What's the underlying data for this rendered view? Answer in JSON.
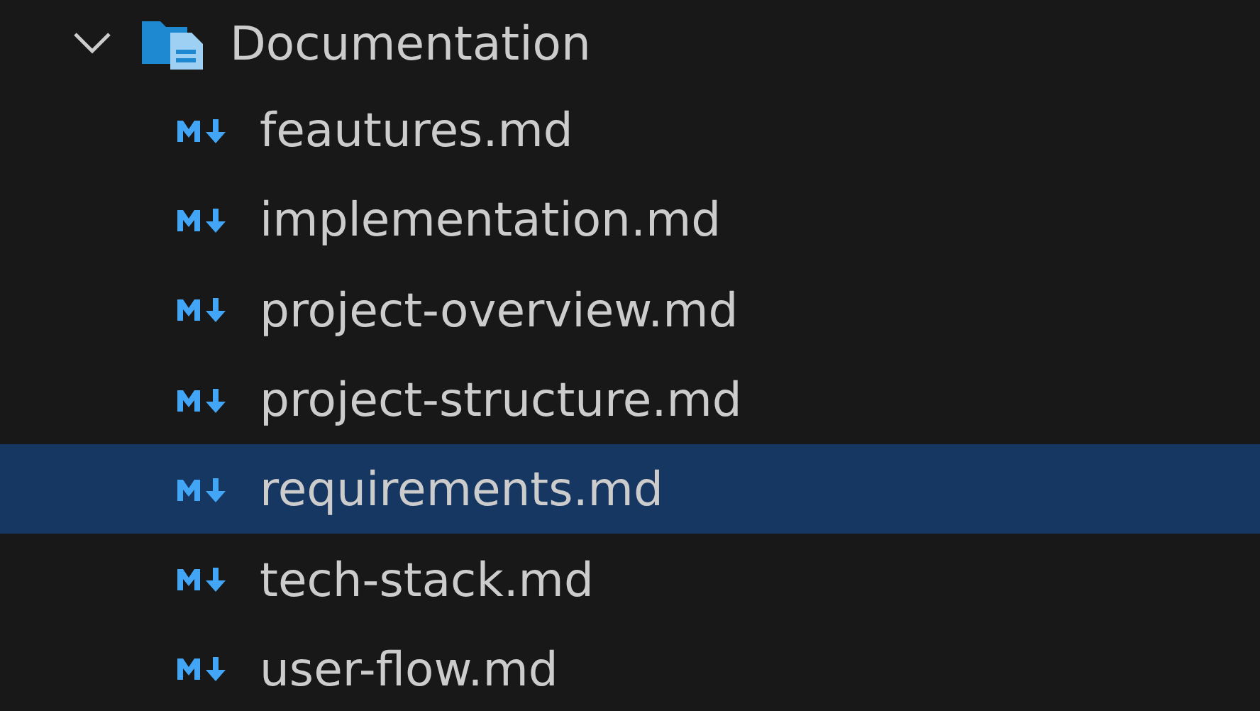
{
  "explorer": {
    "folder": {
      "name": "Documentation",
      "expanded": true,
      "children": [
        {
          "name": "feautures.md",
          "selected": false
        },
        {
          "name": "implementation.md",
          "selected": false
        },
        {
          "name": "project-overview.md",
          "selected": false
        },
        {
          "name": "project-structure.md",
          "selected": false
        },
        {
          "name": "requirements.md",
          "selected": true
        },
        {
          "name": "tech-stack.md",
          "selected": false
        },
        {
          "name": "user-flow.md",
          "selected": false
        }
      ]
    }
  }
}
